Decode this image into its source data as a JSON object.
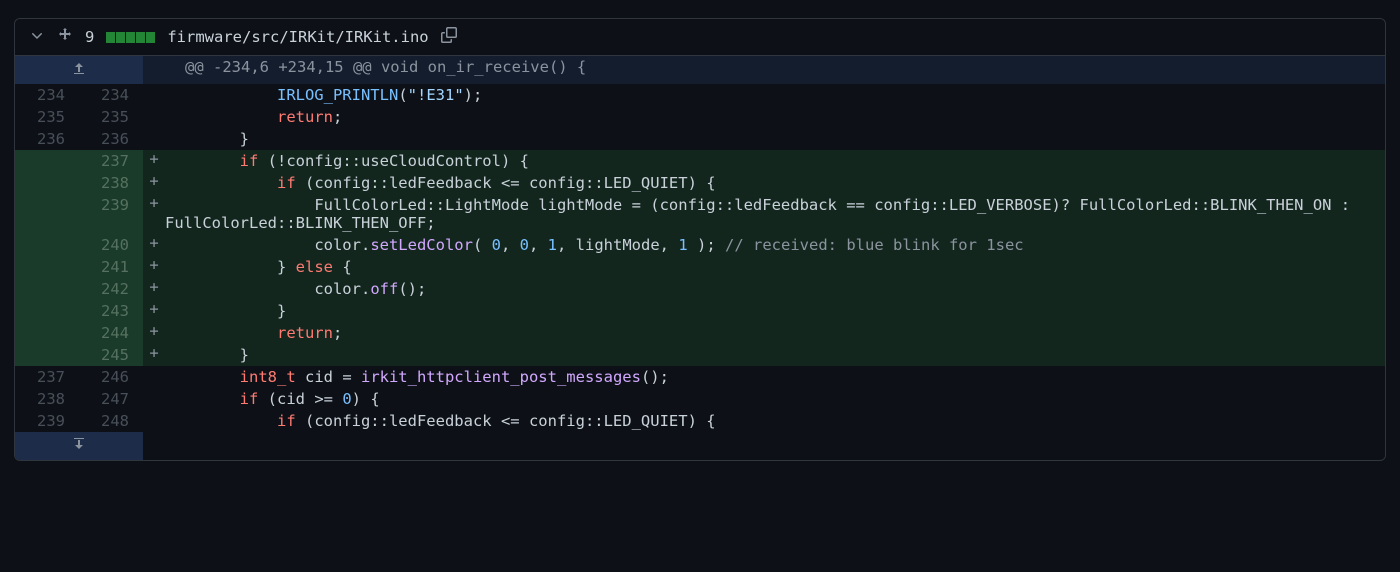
{
  "header": {
    "change_count": "9",
    "filepath": "firmware/src/IRKit/IRKit.ino"
  },
  "hunk": "@@ -234,6 +234,15 @@ void on_ir_receive() {",
  "rows": [
    {
      "t": "ctx",
      "old": "234",
      "new": "234",
      "sign": "",
      "tokens": [
        [
          "pl",
          "            "
        ],
        [
          "fn2",
          "IRLOG_PRINTLN"
        ],
        [
          "pl",
          "("
        ],
        [
          "str",
          "\"!E31\""
        ],
        [
          "pl",
          ");"
        ]
      ]
    },
    {
      "t": "ctx",
      "old": "235",
      "new": "235",
      "sign": "",
      "tokens": [
        [
          "pl",
          "            "
        ],
        [
          "kw",
          "return"
        ],
        [
          "pl",
          ";"
        ]
      ]
    },
    {
      "t": "ctx",
      "old": "236",
      "new": "236",
      "sign": "",
      "tokens": [
        [
          "pl",
          "        }"
        ]
      ]
    },
    {
      "t": "add",
      "old": "",
      "new": "237",
      "sign": "+",
      "tokens": [
        [
          "pl",
          "        "
        ],
        [
          "kw",
          "if"
        ],
        [
          "pl",
          " (!config::useCloudControl) {"
        ]
      ]
    },
    {
      "t": "add",
      "old": "",
      "new": "238",
      "sign": "+",
      "tokens": [
        [
          "pl",
          "            "
        ],
        [
          "kw",
          "if"
        ],
        [
          "pl",
          " (config::ledFeedback <= config::LED_QUIET) {"
        ]
      ]
    },
    {
      "t": "add",
      "old": "",
      "new": "239",
      "sign": "+",
      "tokens": [
        [
          "pl",
          "                FullColorLed::LightMode lightMode = (config::ledFeedback == config::LED_VERBOSE)? FullColorLed::BLINK_THEN_ON : FullColorLed::BLINK_THEN_OFF;"
        ]
      ]
    },
    {
      "t": "add",
      "old": "",
      "new": "240",
      "sign": "+",
      "tokens": [
        [
          "pl",
          "                color."
        ],
        [
          "fn",
          "setLedColor"
        ],
        [
          "pl",
          "( "
        ],
        [
          "num",
          "0"
        ],
        [
          "pl",
          ", "
        ],
        [
          "num",
          "0"
        ],
        [
          "pl",
          ", "
        ],
        [
          "num",
          "1"
        ],
        [
          "pl",
          ", lightMode, "
        ],
        [
          "num",
          "1"
        ],
        [
          "pl",
          " ); "
        ],
        [
          "cm",
          "// received: blue blink for 1sec"
        ]
      ]
    },
    {
      "t": "add",
      "old": "",
      "new": "241",
      "sign": "+",
      "tokens": [
        [
          "pl",
          "            } "
        ],
        [
          "kw",
          "else"
        ],
        [
          "pl",
          " {"
        ]
      ]
    },
    {
      "t": "add",
      "old": "",
      "new": "242",
      "sign": "+",
      "tokens": [
        [
          "pl",
          "                color."
        ],
        [
          "fn",
          "off"
        ],
        [
          "pl",
          "();"
        ]
      ]
    },
    {
      "t": "add",
      "old": "",
      "new": "243",
      "sign": "+",
      "tokens": [
        [
          "pl",
          "            }"
        ]
      ]
    },
    {
      "t": "add",
      "old": "",
      "new": "244",
      "sign": "+",
      "tokens": [
        [
          "pl",
          "            "
        ],
        [
          "kw",
          "return"
        ],
        [
          "pl",
          ";"
        ]
      ]
    },
    {
      "t": "add",
      "old": "",
      "new": "245",
      "sign": "+",
      "tokens": [
        [
          "pl",
          "        }"
        ]
      ]
    },
    {
      "t": "ctx",
      "old": "237",
      "new": "246",
      "sign": "",
      "tokens": [
        [
          "pl",
          "        "
        ],
        [
          "kw",
          "int8_t"
        ],
        [
          "pl",
          " cid = "
        ],
        [
          "fn",
          "irkit_httpclient_post_messages"
        ],
        [
          "pl",
          "();"
        ]
      ]
    },
    {
      "t": "ctx",
      "old": "238",
      "new": "247",
      "sign": "",
      "tokens": [
        [
          "pl",
          "        "
        ],
        [
          "kw",
          "if"
        ],
        [
          "pl",
          " (cid >= "
        ],
        [
          "num",
          "0"
        ],
        [
          "pl",
          ") {"
        ]
      ]
    },
    {
      "t": "ctx",
      "old": "239",
      "new": "248",
      "sign": "",
      "tokens": [
        [
          "pl",
          "            "
        ],
        [
          "kw",
          "if"
        ],
        [
          "pl",
          " (config::ledFeedback <= config::LED_QUIET) {"
        ]
      ]
    }
  ]
}
